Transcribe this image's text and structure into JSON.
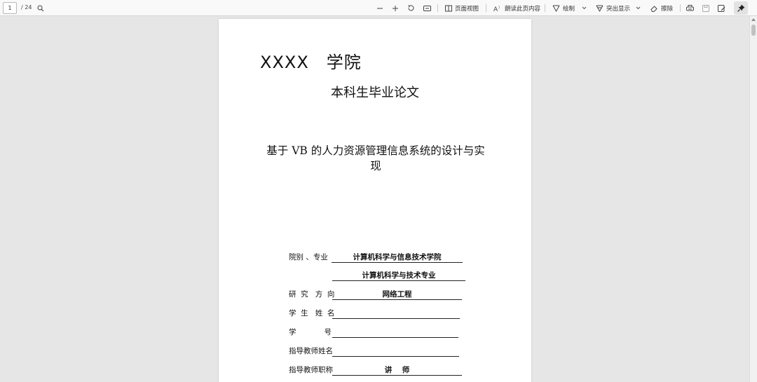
{
  "toolbar": {
    "page_current": "1",
    "page_total": "/ 24",
    "page_view_label": "页面视图",
    "read_aloud_label": "朗读此页内容",
    "draw_label": "绘制",
    "highlight_label": "突出显示",
    "erase_label": "擦除",
    "icons": [
      "search-icon",
      "zoom-out-icon",
      "zoom-in-icon",
      "rotate-icon",
      "fit-page-icon",
      "page-view-icon",
      "read-aloud-icon",
      "draw-icon",
      "highlight-icon",
      "erase-icon",
      "print-icon",
      "save-icon",
      "save-as-icon",
      "pin-icon"
    ]
  },
  "document": {
    "college": "XXXX　学院",
    "subtitle": "本科生毕业论文",
    "title_line1": "基于 VB 的人力资源管理信息系统的设计与实",
    "title_line2": "现",
    "fields": [
      {
        "label": "院别 、专业",
        "value": "计算机科学与信息技术学院"
      },
      {
        "label": "",
        "value": "计算机科学与技术专业"
      },
      {
        "label": "研  究   方  向",
        "value": "网络工程"
      },
      {
        "label": "学  生   姓  名",
        "value": ""
      },
      {
        "label": "学            号",
        "value": ""
      },
      {
        "label": "指导教师姓名",
        "value": ""
      },
      {
        "label": "指导教师职称",
        "value": "讲    师"
      }
    ]
  }
}
